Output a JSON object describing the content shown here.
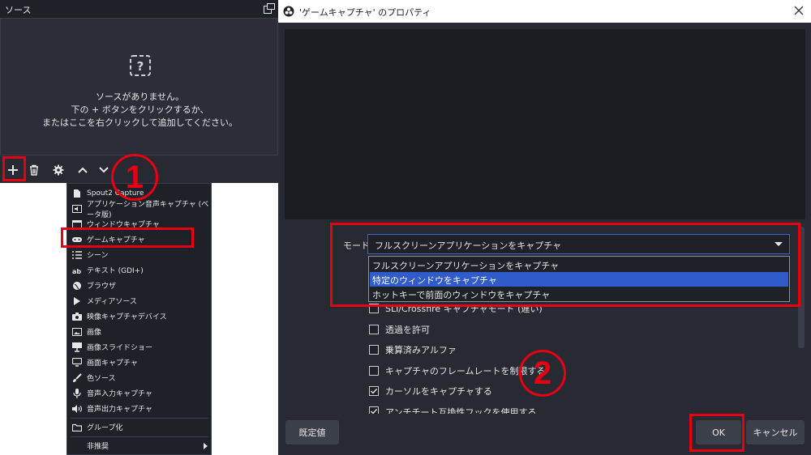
{
  "sources_dock": {
    "title": "ソース",
    "empty_line1": "ソースがありません。",
    "empty_line2": "下の + ボタンをクリックするか、",
    "empty_line3": "またはここを右クリックして追加してください。",
    "toolbar_icons": [
      "plus-icon",
      "trash-icon",
      "gear-icon",
      "chevron-up-icon",
      "chevron-down-icon"
    ]
  },
  "context_menu": {
    "items": [
      {
        "label": "Spout2 Capture",
        "icon": "file-icon"
      },
      {
        "label": "アプリケーション音声キャプチャ (ベータ版)",
        "icon": "app-audio-icon"
      },
      {
        "label": "ウィンドウキャプチャ",
        "icon": "window-icon"
      },
      {
        "label": "ゲームキャプチャ",
        "icon": "gamepad-icon"
      },
      {
        "label": "シーン",
        "icon": "list-icon"
      },
      {
        "label": "テキスト (GDI+)",
        "icon": "text-icon"
      },
      {
        "label": "ブラウザ",
        "icon": "globe-icon"
      },
      {
        "label": "メディアソース",
        "icon": "play-icon"
      },
      {
        "label": "映像キャプチャデバイス",
        "icon": "camera-icon"
      },
      {
        "label": "画像",
        "icon": "image-icon"
      },
      {
        "label": "画像スライドショー",
        "icon": "slideshow-icon"
      },
      {
        "label": "画面キャプチャ",
        "icon": "monitor-icon"
      },
      {
        "label": "色ソース",
        "icon": "brush-icon"
      },
      {
        "label": "音声入力キャプチャ",
        "icon": "mic-icon"
      },
      {
        "label": "音声出力キャプチャ",
        "icon": "speaker-icon"
      },
      {
        "label": "グループ化",
        "icon": "folder-icon"
      },
      {
        "label": "非推奨",
        "icon": ""
      }
    ]
  },
  "properties": {
    "title": "'ゲームキャプチャ' のプロパティ",
    "mode_label": "モード",
    "mode_value": "フルスクリーンアプリケーションをキャプチャ",
    "mode_options": [
      "フルスクリーンアプリケーションをキャプチャ",
      "特定のウィンドウをキャプチャ",
      "ホットキーで前面のウィンドウをキャプチャ"
    ],
    "checkboxes": [
      {
        "label": "SLI/Crossfire キャプチャモード (遅い)",
        "checked": false
      },
      {
        "label": "透過を許可",
        "checked": false
      },
      {
        "label": "乗算済みアルファ",
        "checked": false
      },
      {
        "label": "キャプチャのフレームレートを制限する",
        "checked": false
      },
      {
        "label": "カーソルをキャプチャする",
        "checked": true
      },
      {
        "label": "アンチチート互換性フックを使用する",
        "checked": true
      }
    ],
    "defaults_button": "既定値",
    "ok_button": "OK",
    "cancel_button": "キャンセル"
  },
  "annotations": {
    "step1": "1",
    "step2": "2",
    "color": "#e60012"
  }
}
